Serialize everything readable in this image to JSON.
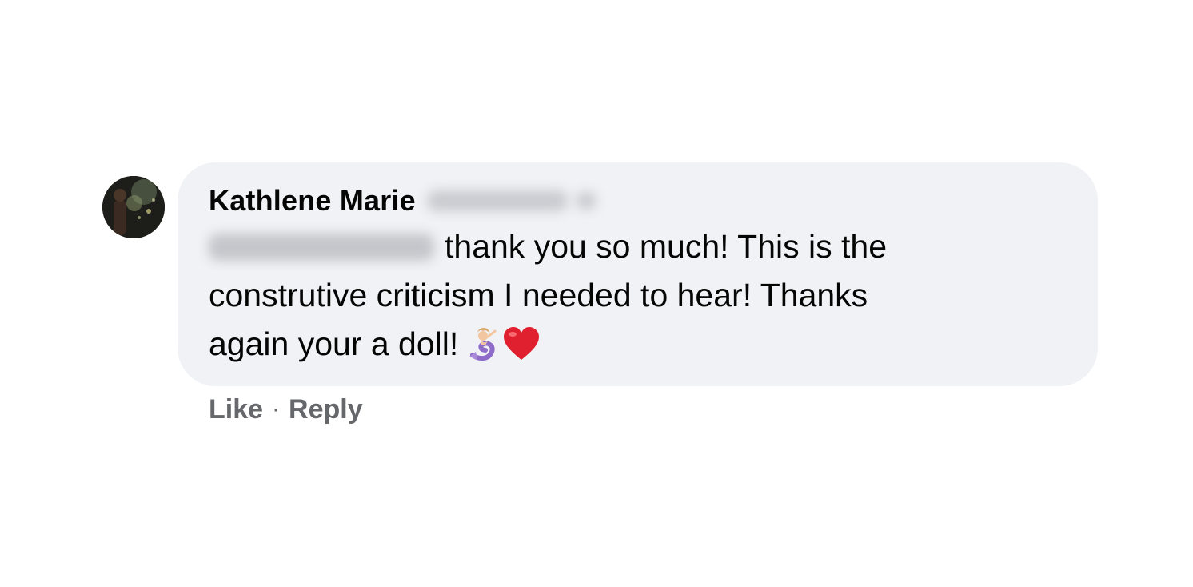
{
  "comment": {
    "author_name": "Kathlene Marie",
    "author_surname_redacted": true,
    "mention_redacted": true,
    "text_lines": [
      "thank you so much! This is the",
      "construtive criticism I needed to hear! Thanks",
      "again your a doll!"
    ],
    "emojis": [
      "mermaid-emoji",
      "red-heart-emoji"
    ],
    "bubble_color": "#f0f2f5"
  },
  "actions": {
    "like_label": "Like",
    "separator": "·",
    "reply_label": "Reply",
    "color": "#65676b"
  }
}
